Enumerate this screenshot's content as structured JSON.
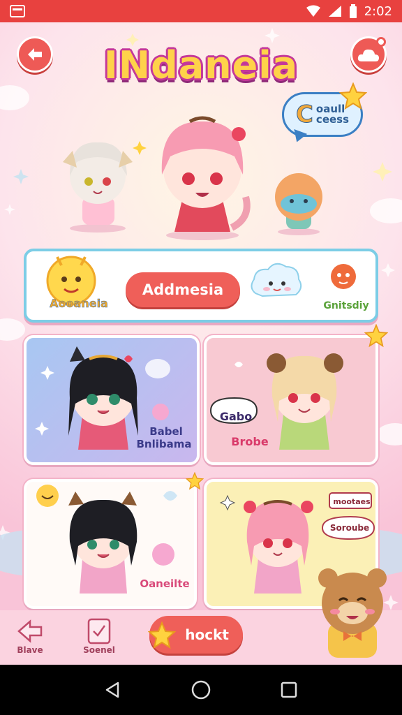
{
  "status_bar": {
    "time": "2:02"
  },
  "header": {
    "title": "INdaneia"
  },
  "speech_bubble": {
    "big_letter": "C",
    "line1": "oaull",
    "line2": "ceess"
  },
  "banner": {
    "left_label": "Aooaneia",
    "button_label": "Addmesia",
    "right_label": "Gnitsdiy"
  },
  "cards": [
    {
      "line1": "Babel",
      "line2": "Bnlibama"
    },
    {
      "line1": "Gabo",
      "line2": "Brobe"
    },
    {
      "line1": "Oaneilte"
    },
    {
      "line1": "mootaes",
      "line2": "Soroube"
    }
  ],
  "toolbar": {
    "back_label": "Blave",
    "notes_label": "Soenel",
    "cta_label": "hockt"
  },
  "colors": {
    "accent": "#ef5f59",
    "status": "#e8413f",
    "background": "#f9c6d8"
  }
}
